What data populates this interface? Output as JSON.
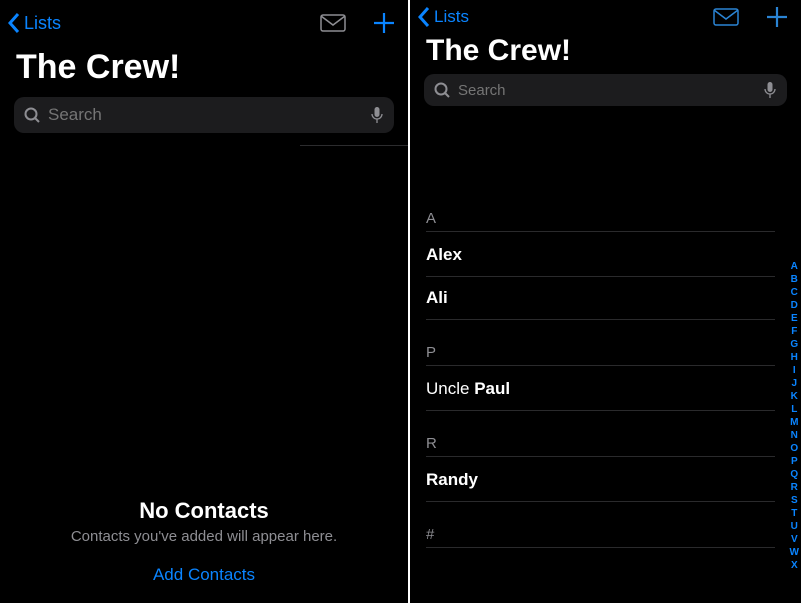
{
  "left": {
    "back_label": "Lists",
    "title": "The Crew!",
    "search_placeholder": "Search",
    "empty_title": "No Contacts",
    "empty_sub": "Contacts you've added will appear here.",
    "add_link": "Add Contacts"
  },
  "right": {
    "back_label": "Lists",
    "title": "The Crew!",
    "search_placeholder": "Search",
    "sections": {
      "A": {
        "header": "A",
        "rows": [
          "Alex",
          "Ali"
        ]
      },
      "P": {
        "header": "P",
        "row_light": "Uncle ",
        "row_bold": "Paul"
      },
      "R": {
        "header": "R",
        "rows": [
          "Randy"
        ]
      },
      "hash": {
        "header": "#"
      }
    },
    "index_letters": [
      "A",
      "B",
      "C",
      "D",
      "E",
      "F",
      "G",
      "H",
      "I",
      "J",
      "K",
      "L",
      "M",
      "N",
      "O",
      "P",
      "Q",
      "R",
      "S",
      "T",
      "U",
      "V",
      "W",
      "X"
    ]
  }
}
